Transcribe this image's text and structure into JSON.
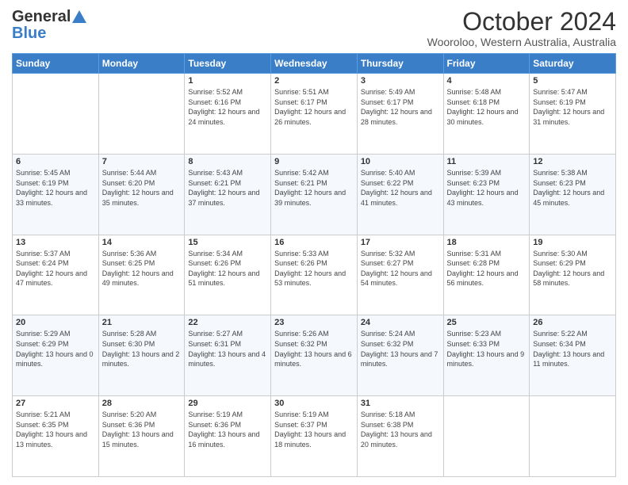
{
  "header": {
    "logo_general": "General",
    "logo_blue": "Blue",
    "month_title": "October 2024",
    "location": "Wooroloo, Western Australia, Australia"
  },
  "weekdays": [
    "Sunday",
    "Monday",
    "Tuesday",
    "Wednesday",
    "Thursday",
    "Friday",
    "Saturday"
  ],
  "weeks": [
    [
      {
        "day": "",
        "sunrise": "",
        "sunset": "",
        "daylight": ""
      },
      {
        "day": "",
        "sunrise": "",
        "sunset": "",
        "daylight": ""
      },
      {
        "day": "1",
        "sunrise": "Sunrise: 5:52 AM",
        "sunset": "Sunset: 6:16 PM",
        "daylight": "Daylight: 12 hours and 24 minutes."
      },
      {
        "day": "2",
        "sunrise": "Sunrise: 5:51 AM",
        "sunset": "Sunset: 6:17 PM",
        "daylight": "Daylight: 12 hours and 26 minutes."
      },
      {
        "day": "3",
        "sunrise": "Sunrise: 5:49 AM",
        "sunset": "Sunset: 6:17 PM",
        "daylight": "Daylight: 12 hours and 28 minutes."
      },
      {
        "day": "4",
        "sunrise": "Sunrise: 5:48 AM",
        "sunset": "Sunset: 6:18 PM",
        "daylight": "Daylight: 12 hours and 30 minutes."
      },
      {
        "day": "5",
        "sunrise": "Sunrise: 5:47 AM",
        "sunset": "Sunset: 6:19 PM",
        "daylight": "Daylight: 12 hours and 31 minutes."
      }
    ],
    [
      {
        "day": "6",
        "sunrise": "Sunrise: 5:45 AM",
        "sunset": "Sunset: 6:19 PM",
        "daylight": "Daylight: 12 hours and 33 minutes."
      },
      {
        "day": "7",
        "sunrise": "Sunrise: 5:44 AM",
        "sunset": "Sunset: 6:20 PM",
        "daylight": "Daylight: 12 hours and 35 minutes."
      },
      {
        "day": "8",
        "sunrise": "Sunrise: 5:43 AM",
        "sunset": "Sunset: 6:21 PM",
        "daylight": "Daylight: 12 hours and 37 minutes."
      },
      {
        "day": "9",
        "sunrise": "Sunrise: 5:42 AM",
        "sunset": "Sunset: 6:21 PM",
        "daylight": "Daylight: 12 hours and 39 minutes."
      },
      {
        "day": "10",
        "sunrise": "Sunrise: 5:40 AM",
        "sunset": "Sunset: 6:22 PM",
        "daylight": "Daylight: 12 hours and 41 minutes."
      },
      {
        "day": "11",
        "sunrise": "Sunrise: 5:39 AM",
        "sunset": "Sunset: 6:23 PM",
        "daylight": "Daylight: 12 hours and 43 minutes."
      },
      {
        "day": "12",
        "sunrise": "Sunrise: 5:38 AM",
        "sunset": "Sunset: 6:23 PM",
        "daylight": "Daylight: 12 hours and 45 minutes."
      }
    ],
    [
      {
        "day": "13",
        "sunrise": "Sunrise: 5:37 AM",
        "sunset": "Sunset: 6:24 PM",
        "daylight": "Daylight: 12 hours and 47 minutes."
      },
      {
        "day": "14",
        "sunrise": "Sunrise: 5:36 AM",
        "sunset": "Sunset: 6:25 PM",
        "daylight": "Daylight: 12 hours and 49 minutes."
      },
      {
        "day": "15",
        "sunrise": "Sunrise: 5:34 AM",
        "sunset": "Sunset: 6:26 PM",
        "daylight": "Daylight: 12 hours and 51 minutes."
      },
      {
        "day": "16",
        "sunrise": "Sunrise: 5:33 AM",
        "sunset": "Sunset: 6:26 PM",
        "daylight": "Daylight: 12 hours and 53 minutes."
      },
      {
        "day": "17",
        "sunrise": "Sunrise: 5:32 AM",
        "sunset": "Sunset: 6:27 PM",
        "daylight": "Daylight: 12 hours and 54 minutes."
      },
      {
        "day": "18",
        "sunrise": "Sunrise: 5:31 AM",
        "sunset": "Sunset: 6:28 PM",
        "daylight": "Daylight: 12 hours and 56 minutes."
      },
      {
        "day": "19",
        "sunrise": "Sunrise: 5:30 AM",
        "sunset": "Sunset: 6:29 PM",
        "daylight": "Daylight: 12 hours and 58 minutes."
      }
    ],
    [
      {
        "day": "20",
        "sunrise": "Sunrise: 5:29 AM",
        "sunset": "Sunset: 6:29 PM",
        "daylight": "Daylight: 13 hours and 0 minutes."
      },
      {
        "day": "21",
        "sunrise": "Sunrise: 5:28 AM",
        "sunset": "Sunset: 6:30 PM",
        "daylight": "Daylight: 13 hours and 2 minutes."
      },
      {
        "day": "22",
        "sunrise": "Sunrise: 5:27 AM",
        "sunset": "Sunset: 6:31 PM",
        "daylight": "Daylight: 13 hours and 4 minutes."
      },
      {
        "day": "23",
        "sunrise": "Sunrise: 5:26 AM",
        "sunset": "Sunset: 6:32 PM",
        "daylight": "Daylight: 13 hours and 6 minutes."
      },
      {
        "day": "24",
        "sunrise": "Sunrise: 5:24 AM",
        "sunset": "Sunset: 6:32 PM",
        "daylight": "Daylight: 13 hours and 7 minutes."
      },
      {
        "day": "25",
        "sunrise": "Sunrise: 5:23 AM",
        "sunset": "Sunset: 6:33 PM",
        "daylight": "Daylight: 13 hours and 9 minutes."
      },
      {
        "day": "26",
        "sunrise": "Sunrise: 5:22 AM",
        "sunset": "Sunset: 6:34 PM",
        "daylight": "Daylight: 13 hours and 11 minutes."
      }
    ],
    [
      {
        "day": "27",
        "sunrise": "Sunrise: 5:21 AM",
        "sunset": "Sunset: 6:35 PM",
        "daylight": "Daylight: 13 hours and 13 minutes."
      },
      {
        "day": "28",
        "sunrise": "Sunrise: 5:20 AM",
        "sunset": "Sunset: 6:36 PM",
        "daylight": "Daylight: 13 hours and 15 minutes."
      },
      {
        "day": "29",
        "sunrise": "Sunrise: 5:19 AM",
        "sunset": "Sunset: 6:36 PM",
        "daylight": "Daylight: 13 hours and 16 minutes."
      },
      {
        "day": "30",
        "sunrise": "Sunrise: 5:19 AM",
        "sunset": "Sunset: 6:37 PM",
        "daylight": "Daylight: 13 hours and 18 minutes."
      },
      {
        "day": "31",
        "sunrise": "Sunrise: 5:18 AM",
        "sunset": "Sunset: 6:38 PM",
        "daylight": "Daylight: 13 hours and 20 minutes."
      },
      {
        "day": "",
        "sunrise": "",
        "sunset": "",
        "daylight": ""
      },
      {
        "day": "",
        "sunrise": "",
        "sunset": "",
        "daylight": ""
      }
    ]
  ]
}
